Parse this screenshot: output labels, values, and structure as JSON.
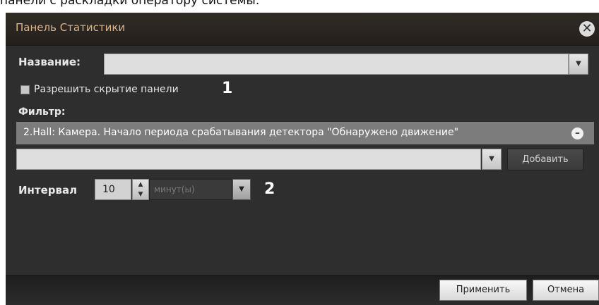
{
  "caption_fragment": "панели с раскладки оператору системы.",
  "dialog": {
    "title": "Панель Статистики",
    "close_glyph": "✕"
  },
  "name_field": {
    "label": "Название:",
    "value": ""
  },
  "hide_panel": {
    "label": "Разрешить скрытие панели",
    "checked": false,
    "marker": "1"
  },
  "filter": {
    "label": "Фильтр:",
    "item": "2.Hall: Камера. Начало периода срабатывания детектора \"Обнаружено движение\"",
    "add_label": "Добавить",
    "new_value": ""
  },
  "interval": {
    "label": "Интервал",
    "value": "10",
    "unit": "минут(ы)",
    "marker": "2"
  },
  "footer": {
    "apply_label": "Применить",
    "cancel_label": "Отмена"
  },
  "colors": {
    "dialog_bg": "#2e2e2e",
    "title_text": "#d9b58a",
    "filter_row": "#7c7c7c"
  },
  "icons": {
    "close": "close-icon",
    "dropdown": "chevron-down-icon",
    "remove": "minus-circle-icon",
    "spin_up": "triangle-up-icon",
    "spin_down": "triangle-down-icon"
  }
}
